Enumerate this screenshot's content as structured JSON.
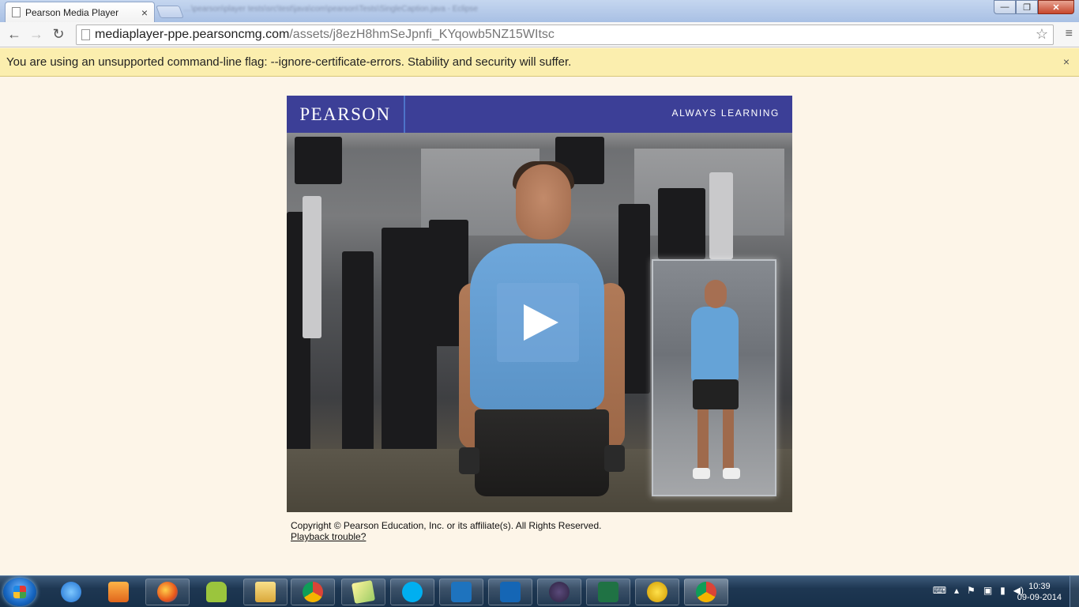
{
  "browser": {
    "tab_title": "Pearson Media Player",
    "tab_close": "×",
    "blurred_window_title": "…\\pearson\\player tests\\src\\test\\java\\com\\pearson\\Tests\\SingleCaption.java - Eclipse",
    "url_domain": "mediaplayer-ppe.pearsoncmg.com",
    "url_path": "/assets/j8ezH8hmSeJpnfi_KYqowb5NZ15WItsc",
    "back_icon": "←",
    "forward_icon": "→",
    "reload_icon": "↻",
    "star_icon": "☆",
    "menu_icon": "≡",
    "win_minimize": "—",
    "win_maximize": "❐",
    "win_close": "✕"
  },
  "infobar": {
    "message": "You are using an unsupported command-line flag: --ignore-certificate-errors. Stability and security will suffer.",
    "close": "×"
  },
  "player": {
    "brand": "PEARSON",
    "tagline": "ALWAYS LEARNING",
    "copyright": "Copyright © Pearson Education, Inc. or its affiliate(s). All Rights Reserved.",
    "playback_link": "Playback trouble?"
  },
  "taskbar": {
    "apps": [
      "ie-icon",
      "media-player-icon",
      "firefox-icon",
      "android-icon",
      "explorer-icon",
      "chrome-icon",
      "notes-icon",
      "skype-icon",
      "lync-icon",
      "outlook-icon",
      "java-ee-ide-icon",
      "excel-icon",
      "norton-icon",
      "chrome-active-icon"
    ],
    "time": "10:39",
    "date": "09-09-2014"
  }
}
